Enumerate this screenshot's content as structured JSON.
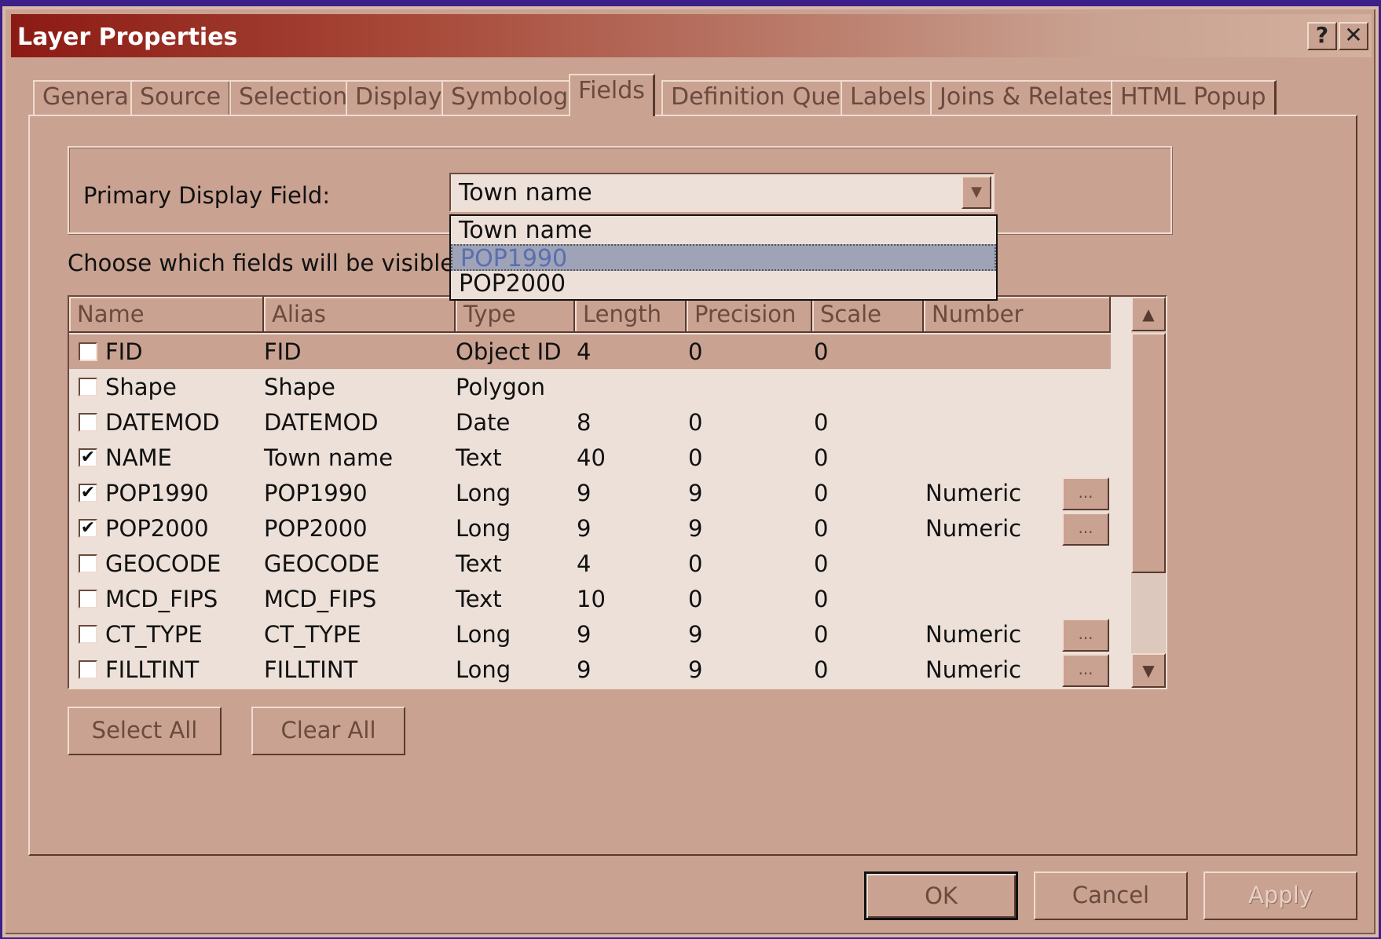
{
  "window": {
    "title": "Layer Properties",
    "help_label": "?",
    "close_label": "✕"
  },
  "tabs": [
    {
      "label": "General"
    },
    {
      "label": "Source"
    },
    {
      "label": "Selection"
    },
    {
      "label": "Display"
    },
    {
      "label": "Symbology"
    },
    {
      "label": "Fields",
      "active": true
    },
    {
      "label": "Definition Query"
    },
    {
      "label": "Labels"
    },
    {
      "label": "Joins & Relates"
    },
    {
      "label": "HTML Popup"
    }
  ],
  "primary_display": {
    "label": "Primary Display Field:",
    "value": "Town name",
    "options": [
      "Town name",
      "POP1990",
      "POP2000"
    ],
    "highlighted_option": "POP1990"
  },
  "instruction": "Choose which fields will be visible. Click",
  "table": {
    "columns": [
      "Name",
      "Alias",
      "Type",
      "Length",
      "Precision",
      "Scale",
      "Number Format"
    ],
    "rows": [
      {
        "checked": false,
        "name": "FID",
        "alias": "FID",
        "type": "Object ID",
        "length": "4",
        "precision": "0",
        "scale": "0",
        "format": "",
        "has_button": false
      },
      {
        "checked": false,
        "name": "Shape",
        "alias": "Shape",
        "type": "Polygon",
        "length": "",
        "precision": "",
        "scale": "",
        "format": "",
        "has_button": false
      },
      {
        "checked": false,
        "name": "DATEMOD",
        "alias": "DATEMOD",
        "type": "Date",
        "length": "8",
        "precision": "0",
        "scale": "0",
        "format": "",
        "has_button": false
      },
      {
        "checked": true,
        "name": "NAME",
        "alias": "Town name",
        "type": "Text",
        "length": "40",
        "precision": "0",
        "scale": "0",
        "format": "",
        "has_button": false
      },
      {
        "checked": true,
        "name": "POP1990",
        "alias": "POP1990",
        "type": "Long",
        "length": "9",
        "precision": "9",
        "scale": "0",
        "format": "Numeric",
        "has_button": true
      },
      {
        "checked": true,
        "name": "POP2000",
        "alias": "POP2000",
        "type": "Long",
        "length": "9",
        "precision": "9",
        "scale": "0",
        "format": "Numeric",
        "has_button": true
      },
      {
        "checked": false,
        "name": "GEOCODE",
        "alias": "GEOCODE",
        "type": "Text",
        "length": "4",
        "precision": "0",
        "scale": "0",
        "format": "",
        "has_button": false
      },
      {
        "checked": false,
        "name": "MCD_FIPS",
        "alias": "MCD_FIPS",
        "type": "Text",
        "length": "10",
        "precision": "0",
        "scale": "0",
        "format": "",
        "has_button": false
      },
      {
        "checked": false,
        "name": "CT_TYPE",
        "alias": "CT_TYPE",
        "type": "Long",
        "length": "9",
        "precision": "9",
        "scale": "0",
        "format": "Numeric",
        "has_button": true
      },
      {
        "checked": false,
        "name": "FILLTINT",
        "alias": "FILLTINT",
        "type": "Long",
        "length": "9",
        "precision": "9",
        "scale": "0",
        "format": "Numeric",
        "has_button": true
      }
    ],
    "format_button_label": "..."
  },
  "buttons": {
    "select_all": "Select All",
    "clear_all": "Clear All",
    "ok": "OK",
    "cancel": "Cancel",
    "apply": "Apply"
  },
  "colors": {
    "dialog_bg": "#c9a291",
    "title_start": "#8c1a14",
    "desktop": "#3d1f8a"
  }
}
